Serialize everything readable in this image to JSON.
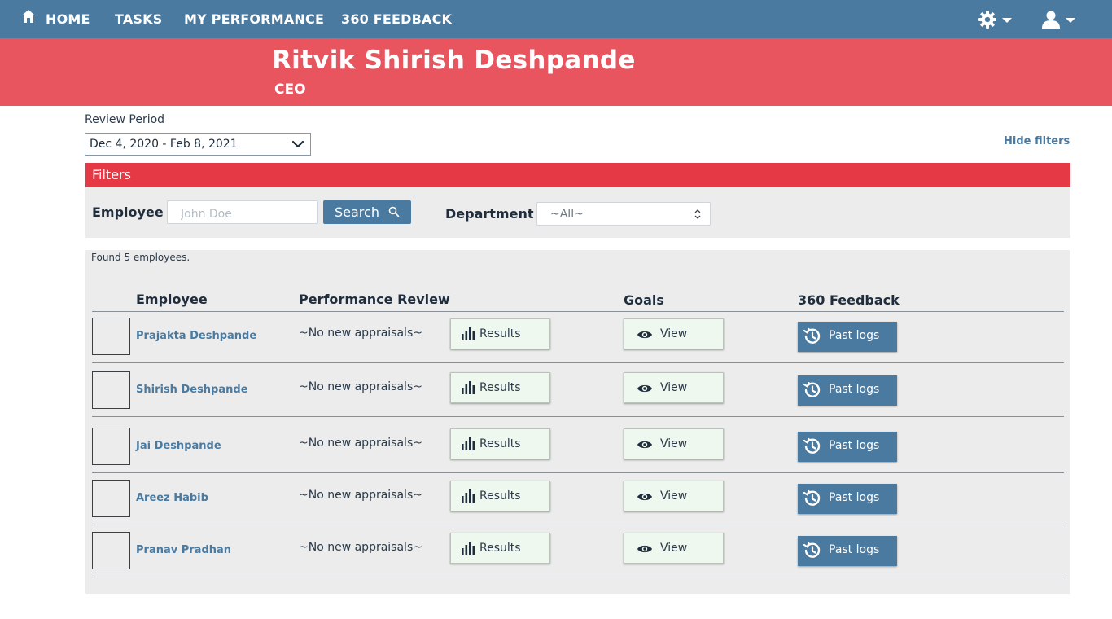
{
  "nav": {
    "home": "HOME",
    "tasks": "TASKS",
    "my_performance": "MY PERFORMANCE",
    "feedback_360": "360 FEEDBACK",
    "home_icon": "home-icon",
    "settings_icon": "gear-icon",
    "user_icon": "user-icon"
  },
  "header": {
    "name": "Ritvik Shirish Deshpande",
    "role": "CEO"
  },
  "review_period": {
    "label": "Review Period",
    "value": "Dec 4, 2020 - Feb 8, 2021"
  },
  "hide_filters": "Hide filters",
  "filters": {
    "title": "Filters",
    "employee_label": "Employee",
    "employee_placeholder": "John Doe",
    "search_label": "Search",
    "department_label": "Department",
    "department_value": "~All~"
  },
  "results": {
    "found_text": "Found 5 employees.",
    "columns": {
      "employee": "Employee",
      "performance_review": "Performance Review",
      "goals": "Goals",
      "feedback_360": "360 Feedback"
    },
    "rows": [
      {
        "name": "Prajakta Deshpande",
        "appraisal": "~No new appraisals~",
        "results_label": "Results",
        "view_label": "View",
        "past_logs_label": "Past logs"
      },
      {
        "name": "Shirish Deshpande",
        "appraisal": "~No new appraisals~",
        "results_label": "Results",
        "view_label": "View",
        "past_logs_label": "Past logs"
      },
      {
        "name": "Jai Deshpande",
        "appraisal": "~No new appraisals~",
        "results_label": "Results",
        "view_label": "View",
        "past_logs_label": "Past logs"
      },
      {
        "name": "Areez Habib",
        "appraisal": "~No new appraisals~",
        "results_label": "Results",
        "view_label": "View",
        "past_logs_label": "Past logs"
      },
      {
        "name": "Pranav Pradhan",
        "appraisal": "~No new appraisals~",
        "results_label": "Results",
        "view_label": "View",
        "past_logs_label": "Past logs"
      }
    ]
  },
  "colors": {
    "navbar": "#4a7aa0",
    "banner": "#e8555f",
    "filters_bar": "#e63946",
    "panel": "#ececec",
    "link": "#4a7aa0",
    "light_button": "#eef8ef"
  }
}
